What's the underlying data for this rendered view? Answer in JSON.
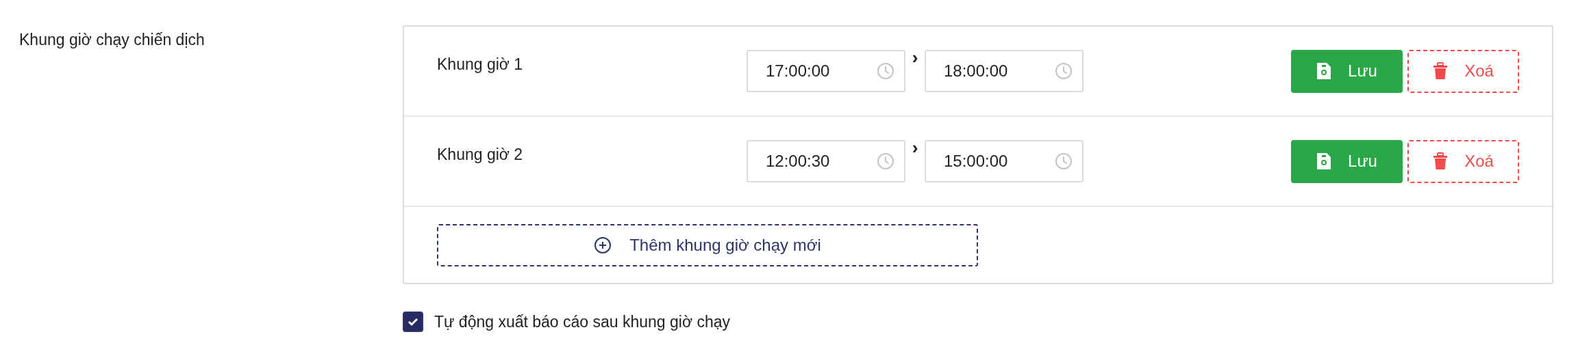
{
  "section_label": "Khung giờ chạy chiến dịch",
  "slots": [
    {
      "name": "Khung giờ 1",
      "start": "17:00:00",
      "separator": "›",
      "end": "18:00:00",
      "save": "Lưu",
      "delete": "Xoá"
    },
    {
      "name": "Khung giờ 2",
      "start": "12:00:30",
      "separator": "›",
      "end": "15:00:00",
      "save": "Lưu",
      "delete": "Xoá"
    }
  ],
  "add_button": "Thêm khung giờ chạy mới",
  "auto_export": {
    "label": "Tự động xuất báo cáo sau khung giờ chạy",
    "checked": true
  }
}
